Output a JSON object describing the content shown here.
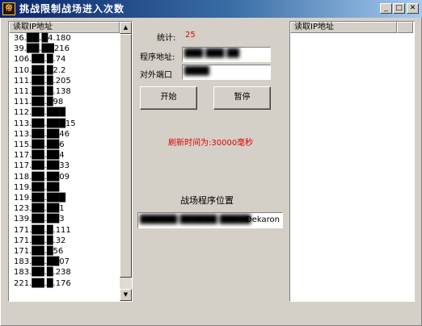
{
  "window": {
    "title": "挑战限制战场进入次数",
    "icon_label": "帝",
    "min_glyph": "_",
    "max_glyph": "□",
    "close_glyph": "✕"
  },
  "left_list": {
    "header": "读取IP地址",
    "rows": [
      "36.██.█4.180",
      "39.██.██216",
      "106.██.█.74",
      "110.██.█2.2",
      "111.██.█.205",
      "111.██.█.138",
      "111.██.█98",
      "112.██.███",
      "113.██.███15",
      "113.██.██46",
      "115.██.██6",
      "117.██.██4",
      "117.██.██33",
      "118.██.██09",
      "119.██.██",
      "119.██.███",
      "123.██.██1",
      "139.██.██3",
      "171.██.█.111",
      "171.██.█.32",
      "171.██.█56",
      "183.██.██07",
      "183.██.█.238",
      "221.██.█.176"
    ]
  },
  "stats": {
    "label": "统计:",
    "value": "25"
  },
  "program_address": {
    "label": "程序地址:",
    "value": "███ ███ ██"
  },
  "external_port": {
    "label": "对外端口",
    "value": "████"
  },
  "buttons": {
    "start": "开始",
    "pause": "暂停"
  },
  "refresh_text": "刷新时间为:30000毫秒",
  "battlefield": {
    "label": "战场程序位置",
    "path_blurred": "██████ ██████ █████",
    "path_suffix": "Dekaron"
  },
  "right_list": {
    "header": "读取IP地址"
  },
  "colors": {
    "title_gradient_start": "#0a246a",
    "title_gradient_end": "#a6caf0",
    "highlight_text": "#e00000",
    "window_bg": "#d4d0c8"
  }
}
